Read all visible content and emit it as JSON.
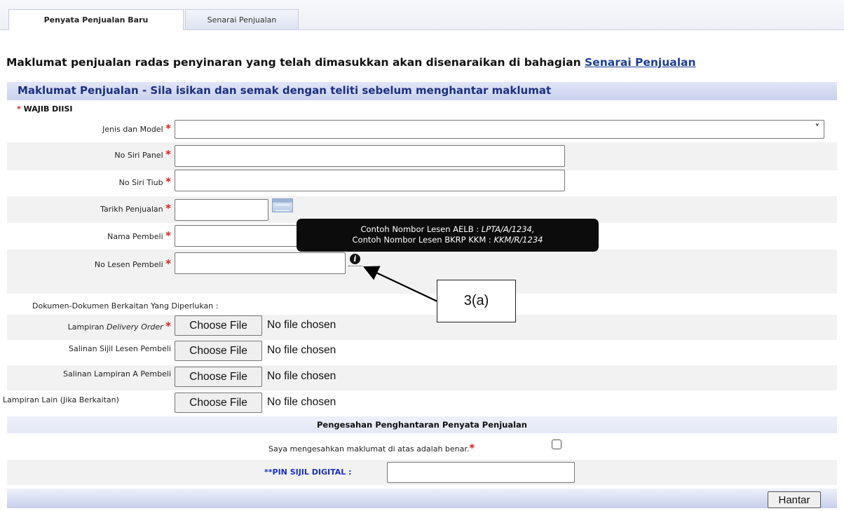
{
  "tabs": {
    "active": "Penyata Penjualan Baru",
    "inactive": "Senarai Penjualan"
  },
  "intro": {
    "text": "Maklumat penjualan radas penyinaran yang telah dimasukkan akan disenaraikan di bahagian ",
    "link": "Senarai Penjualan"
  },
  "section": {
    "title": "Maklumat Penjualan - Sila isikan dan semak dengan teliti sebelum menghantar maklumat",
    "required_star": "*",
    "required_note": "WAJIB DIISI"
  },
  "fields": {
    "jenis_model": {
      "label": "Jenis dan Model",
      "value": ""
    },
    "no_siri_panel": {
      "label": "No Siri Panel",
      "value": ""
    },
    "no_siri_tiub": {
      "label": "No Siri Tiub",
      "value": ""
    },
    "tarikh_penjualan": {
      "label": "Tarikh Penjualan",
      "value": ""
    },
    "nama_pembeli": {
      "label": "Nama Pembeli",
      "value": ""
    },
    "no_lesen_pembeli": {
      "label": "No Lesen Pembeli",
      "value": ""
    }
  },
  "tooltip": {
    "line1_prefix": "Contoh Nombor Lesen AELB : ",
    "line1_example": "LPTA/A/1234,",
    "line2_prefix": "Contoh Nombor Lesen BKRP KKM : ",
    "line2_example": "KKM/R/1234"
  },
  "annotation": {
    "callout": "3(a)"
  },
  "documents": {
    "heading": "Dokumen-Dokumen Berkaitan Yang Diperlukan :",
    "button_label": "Choose File",
    "status": "No file chosen",
    "delivery_order": {
      "label_prefix": "Lampiran ",
      "label_italic": "Delivery Order"
    },
    "sijil_lesen": {
      "label": "Salinan Sijil Lesen Pembeli"
    },
    "lampiran_a": {
      "label": "Salinan Lampiran A Pembeli"
    },
    "lampiran_lain": {
      "label": "Lampiran Lain (Jika Berkaitan)"
    }
  },
  "confirmation": {
    "title": "Pengesahan Penghantaran Penyata Penjualan",
    "statement": "Saya mengesahkan maklumat di atas adalah benar.",
    "checked": false,
    "pin_label": "**PIN SIJIL DIGITAL :",
    "pin_value": ""
  },
  "actions": {
    "submit": "Hantar"
  },
  "colors": {
    "required": "#e01b1b",
    "header_text": "#1c2f82",
    "link": "#1d3f96",
    "pin_label": "#1a2fd0"
  }
}
